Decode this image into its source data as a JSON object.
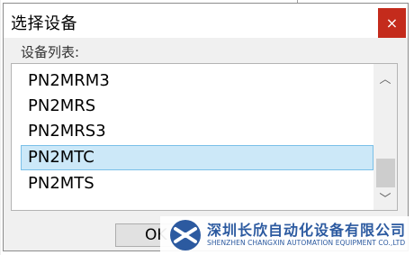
{
  "dialog": {
    "title": "选择设备",
    "close_glyph": "×",
    "list_label": "设备列表:",
    "items": [
      {
        "label": "PN2MRM3",
        "selected": false
      },
      {
        "label": "PN2MRS",
        "selected": false
      },
      {
        "label": "PN2MRS3",
        "selected": false
      },
      {
        "label": "PN2MTC",
        "selected": true
      },
      {
        "label": "PN2MTS",
        "selected": false
      }
    ],
    "scroll_up_glyph": "︿",
    "scroll_down_glyph": "﹀",
    "ok_label": "OK"
  },
  "watermark": {
    "company_cn": "深圳长欣自动化设备有限公司",
    "company_en": "SHENZHEN CHANGXIN AUTOMATION EQUIPMENT CO.,LTD",
    "logo_icon": "changxin-logo-icon"
  },
  "colors": {
    "close_red": "#c42b1c",
    "selection_fill": "#cce8f8",
    "selection_border": "#7ac0e8",
    "brand_blue": "#2c5aa0"
  }
}
